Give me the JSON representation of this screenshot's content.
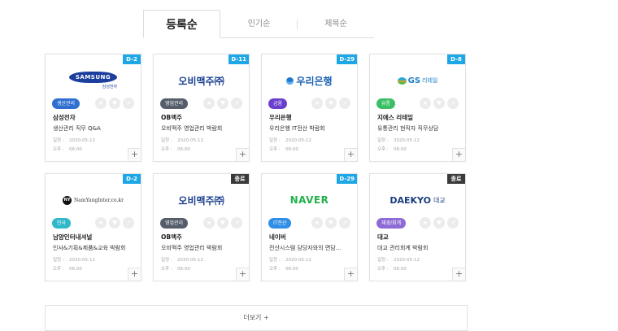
{
  "tabs": [
    {
      "label": "등록순",
      "active": true
    },
    {
      "label": "인기순",
      "active": false
    },
    {
      "label": "제목순",
      "active": false
    }
  ],
  "meta_labels": {
    "date": "일정 :",
    "time": "오후 :"
  },
  "cards": [
    {
      "dday": "D-2",
      "closed": false,
      "logo": "SAMSUNG",
      "logo_sub": "삼성전자",
      "badge": "생산관리",
      "badge_color": "#2f6fd1",
      "company": "삼성전자",
      "title": "생산관리 직무 Q&A",
      "date": "2020-05-12",
      "time": "06:00"
    },
    {
      "dday": "D-11",
      "closed": false,
      "logo": "오비맥주㈜",
      "badge": "영업관리",
      "badge_color": "#555d6b",
      "company": "OB맥주",
      "title": "오비맥주 영업관리 박람회",
      "date": "2020-05-12",
      "time": "06:00"
    },
    {
      "dday": "D-29",
      "closed": false,
      "logo": "우리은행",
      "badge": "금융",
      "badge_color": "#6a3fd0",
      "company": "우리은행",
      "title": "우리은행 IT전산 박람회",
      "date": "2020-05-12",
      "time": "06:00"
    },
    {
      "dday": "D-8",
      "closed": false,
      "logo": "GS",
      "logo_sub": "리테일",
      "badge": "유통",
      "badge_color": "#3bbf64",
      "company": "지에스 리테일",
      "title": "유통관리 현직자 직무상담",
      "date": "2020-05-12",
      "time": "06:00"
    },
    {
      "dday": "D-2",
      "closed": false,
      "logo": "NamYangInter.co.kr",
      "badge": "인사",
      "badge_color": "#30b8c9",
      "company": "남양인터내셔널",
      "title": "인사&기획&제품&교육 박람회",
      "date": "2020-05-12",
      "time": "06:00"
    },
    {
      "dday": "종료",
      "closed": true,
      "logo": "오비맥주㈜",
      "badge": "영업관리",
      "badge_color": "#555d6b",
      "company": "OB맥주",
      "title": "오비맥주 영업관리 박람회",
      "date": "2020-05-12",
      "time": "06:00"
    },
    {
      "dday": "D-29",
      "closed": false,
      "logo": "NAVER",
      "badge": "IT전산",
      "badge_color": "#2f8ee6",
      "company": "네이버",
      "title": "전산시스템 담당자와의 면담...",
      "date": "2020-05-12",
      "time": "06:00"
    },
    {
      "dday": "종료",
      "closed": true,
      "logo": "DAEKYO",
      "logo_sub": "대교",
      "badge": "재경/회계",
      "badge_color": "#8e6ad6",
      "company": "대교",
      "title": "대교 관리회계 박람회",
      "date": "2020-05-12",
      "time": "06:00"
    }
  ],
  "more_label": "더보기 +",
  "colors": {
    "accent": "#1ea7e6",
    "closed": "#3a3a3a"
  }
}
